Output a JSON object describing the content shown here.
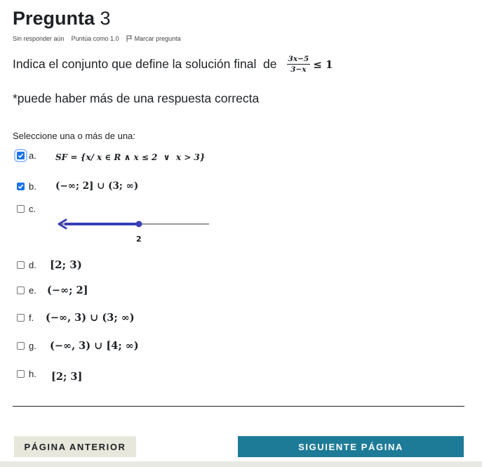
{
  "question": {
    "title_word": "Pregunta",
    "title_number": "3",
    "status": "Sin responder aún",
    "score": "Puntúa como 1.0",
    "flag_label": "Marcar pregunta",
    "text": "Indica el conjunto que define la solución final  de",
    "fraction_num": "3x−5",
    "fraction_den": "3−x",
    "inequality_rhs": "≤ 1",
    "note": "*puede haber más de una respuesta correcta",
    "prompt": "Seleccione una o más de una:"
  },
  "options": [
    {
      "letter": "a.",
      "text": "SF = {x/ x ∈ R ∧ x ≤ 2  ∨  x > 3}",
      "checked": true
    },
    {
      "letter": "b.",
      "text": "(−∞; 2] ∪ (3; ∞)",
      "checked": true
    },
    {
      "letter": "c.",
      "text": "",
      "graph_label": "2",
      "checked": false
    },
    {
      "letter": "d.",
      "text": "[2; 3)",
      "checked": false
    },
    {
      "letter": "e.",
      "text": "(−∞; 2]",
      "checked": false
    },
    {
      "letter": "f.",
      "text": "(−∞, 3) ∪ (3; ∞)",
      "checked": false
    },
    {
      "letter": "g.",
      "text": "(−∞, 3) ∪ [4; ∞)",
      "checked": false
    },
    {
      "letter": "h.",
      "text": "[2; 3]",
      "checked": false
    }
  ],
  "nav": {
    "prev": "PÁGINA ANTERIOR",
    "next": "SIGUIENTE PÁGINA"
  },
  "colors": {
    "checkbox_checked": "#1a73e8",
    "next_button": "#1e7b98",
    "prev_button": "#e8e7dc",
    "graph_line": "#3b3fb6"
  }
}
